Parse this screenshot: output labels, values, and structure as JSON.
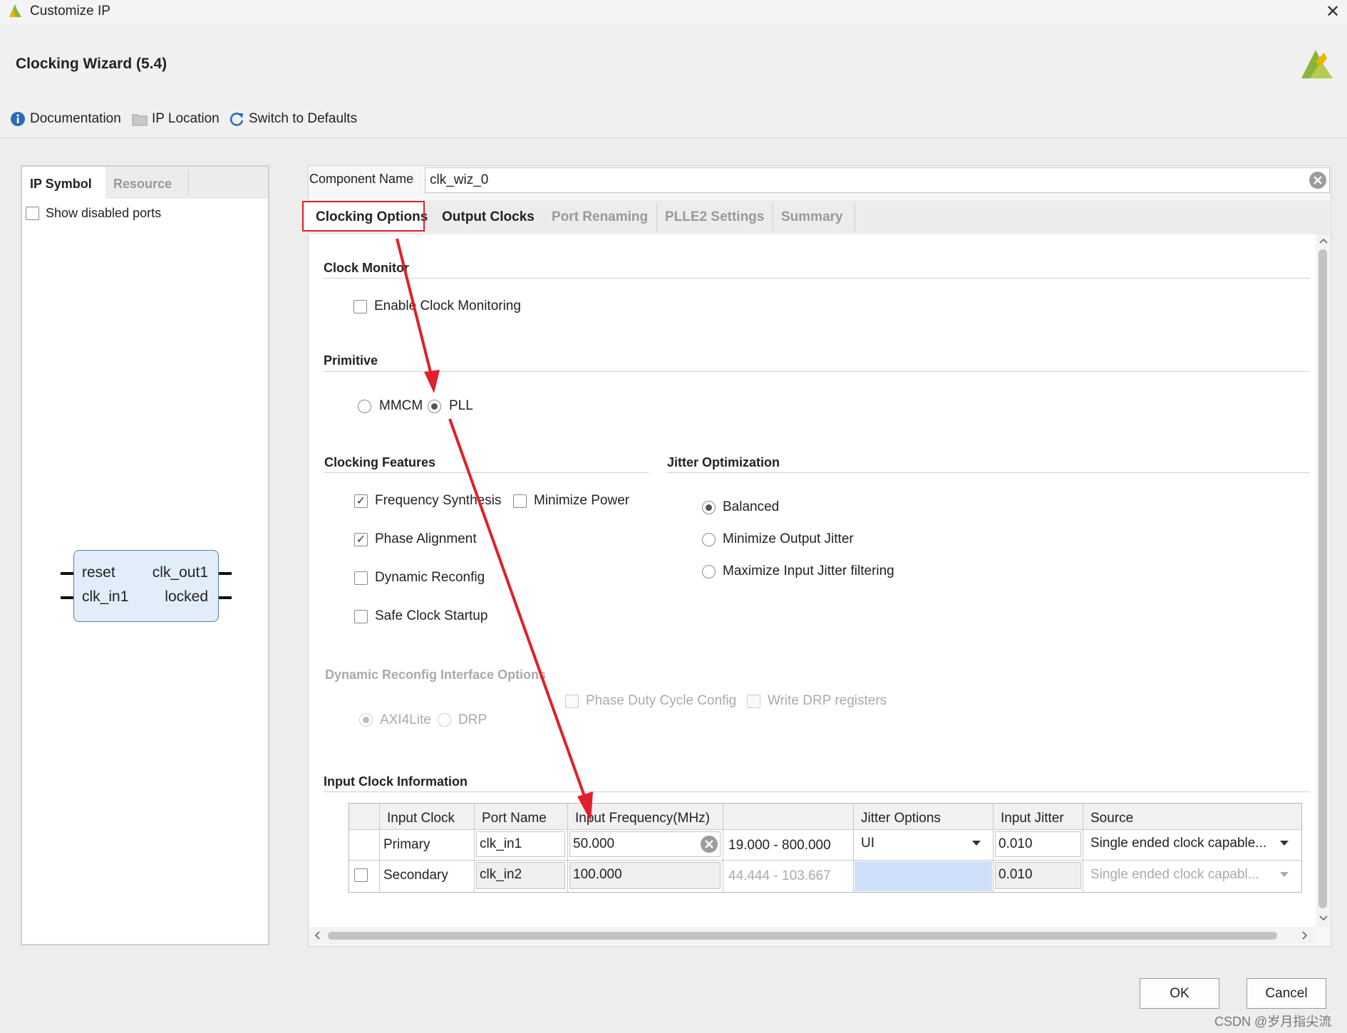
{
  "window": {
    "title": "Customize IP",
    "close": "✕"
  },
  "header": {
    "title": "Clocking Wizard (5.4)"
  },
  "toolbar": {
    "documentation": "Documentation",
    "ip_location": "IP Location",
    "switch_defaults": "Switch to Defaults"
  },
  "left_panel": {
    "tabs": [
      "IP Symbol",
      "Resource"
    ],
    "show_disabled_ports": "Show disabled ports",
    "symbol": {
      "left_ports": [
        "reset",
        "clk_in1"
      ],
      "right_ports": [
        "clk_out1",
        "locked"
      ]
    }
  },
  "component": {
    "label": "Component Name",
    "value": "clk_wiz_0"
  },
  "tabs": [
    "Clocking Options",
    "Output Clocks",
    "Port Renaming",
    "PLLE2 Settings",
    "Summary"
  ],
  "clock_monitor": {
    "title": "Clock Monitor",
    "enable": "Enable Clock Monitoring"
  },
  "primitive": {
    "title": "Primitive",
    "options": [
      "MMCM",
      "PLL"
    ],
    "selected": "PLL"
  },
  "clocking_features": {
    "title": "Clocking Features",
    "frequency_synthesis": "Frequency Synthesis",
    "minimize_power": "Minimize Power",
    "phase_alignment": "Phase Alignment",
    "dynamic_reconfig": "Dynamic Reconfig",
    "safe_clock_startup": "Safe Clock Startup"
  },
  "jitter_optimization": {
    "title": "Jitter Optimization",
    "options": [
      "Balanced",
      "Minimize Output Jitter",
      "Maximize Input Jitter filtering"
    ],
    "selected": "Balanced"
  },
  "dynamic_reconfig_interface": {
    "title": "Dynamic Reconfig Interface Options",
    "axi4lite": "AXI4Lite",
    "drp": "DRP",
    "phase_duty": "Phase Duty Cycle Config",
    "write_drp": "Write DRP registers"
  },
  "input_clock_info": {
    "title": "Input Clock Information",
    "headers": [
      "Input Clock",
      "Port Name",
      "Input Frequency(MHz)",
      "",
      "Jitter Options",
      "Input Jitter",
      "Source"
    ],
    "primary": {
      "clock": "Primary",
      "port": "clk_in1",
      "freq": "50.000",
      "range": "19.000 - 800.000",
      "jitter_option": "UI",
      "input_jitter": "0.010",
      "source": "Single ended clock capable..."
    },
    "secondary": {
      "clock": "Secondary",
      "port": "clk_in2",
      "freq": "100.000",
      "range": "44.444 - 103.667",
      "input_jitter": "0.010",
      "source": "Single ended clock capabl..."
    }
  },
  "buttons": {
    "ok": "OK",
    "cancel": "Cancel"
  },
  "watermark": "CSDN @岁月指尖流",
  "colors": {
    "annotation": "#e0202a",
    "symbol_fill": "#e1edf9",
    "selected_cell": "#cfe0fb"
  }
}
